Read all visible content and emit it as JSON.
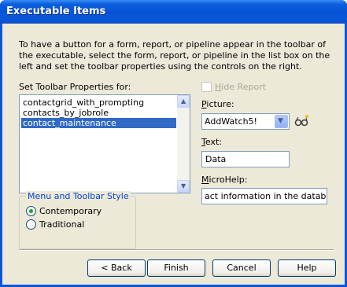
{
  "window": {
    "title": "Executable Items"
  },
  "description": "To have a button for a form, report, or pipeline appear in the toolbar of the executable, select the form, report, or pipeline in the list box on the left and set the toolbar properties using the controls on the right.",
  "left": {
    "list_label": "Set Toolbar Properties for:",
    "items": [
      "contactgrid_with_prompting",
      "contacts_by_jobrole",
      "contact_maintenance"
    ],
    "selected_index": 2,
    "style_group": {
      "legend": "Menu and Toolbar Style",
      "options": [
        "Contemporary",
        "Traditional"
      ],
      "selected": "Contemporary"
    }
  },
  "right": {
    "hide_report": {
      "label_first": "H",
      "label_rest": "ide Report",
      "checked": false,
      "enabled": false
    },
    "picture": {
      "label_first": "P",
      "label_rest": "icture:",
      "value": "AddWatch5!"
    },
    "text": {
      "label_first": "T",
      "label_rest": "ext:",
      "value": "Data"
    },
    "microhelp": {
      "label_first": "M",
      "label_rest": "icroHelp:",
      "value": "act information in the database"
    }
  },
  "buttons": {
    "back": "< Back",
    "finish": "Finish",
    "cancel": "Cancel",
    "help": "Help"
  },
  "colors": {
    "title_bar": "#0a58d8",
    "selection": "#316ac5",
    "group_legend": "#0046d5"
  }
}
